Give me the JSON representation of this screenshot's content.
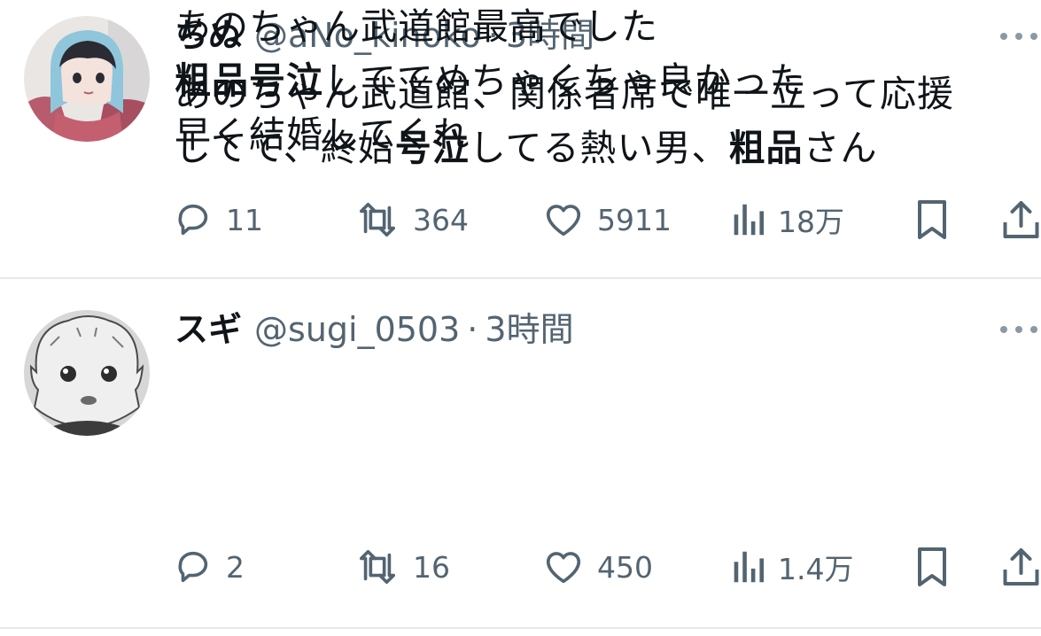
{
  "tweets": [
    {
      "author_name": "ちぬ",
      "handle": "@aNo_kinoko",
      "separator": "·",
      "time": "3時間",
      "text_lines": [
        [
          {
            "t": "あのちゃん武道館、関係者席で唯一立って応援",
            "b": false
          }
        ],
        [
          {
            "t": "してて、終始",
            "b": false
          },
          {
            "t": "号泣",
            "b": true
          },
          {
            "t": "してる熱い男、",
            "b": false
          },
          {
            "t": "粗品",
            "b": true
          },
          {
            "t": "さん",
            "b": false
          }
        ]
      ],
      "replies": "11",
      "retweets": "364",
      "likes": "5911",
      "views": "18万"
    },
    {
      "author_name": "スギ",
      "handle": "@sugi_0503",
      "separator": "·",
      "time": "3時間",
      "text_lines": [
        [
          {
            "t": "あのちゃん武道館最高でした",
            "b": false
          }
        ],
        [
          {
            "t": "粗品号泣",
            "b": true
          },
          {
            "t": "しててめちゃくちゃ良かった",
            "b": false
          }
        ],
        [
          {
            "t": "早く結婚してくれ",
            "b": false
          }
        ]
      ],
      "replies": "2",
      "retweets": "16",
      "likes": "450",
      "views": "1.4万"
    }
  ],
  "icons": {
    "more": "more-horizontal-icon",
    "reply": "reply-icon",
    "retweet": "retweet-icon",
    "like": "heart-icon",
    "views": "views-bar-chart-icon",
    "bookmark": "bookmark-icon",
    "share": "share-icon"
  },
  "colors": {
    "text": "#0f1419",
    "secondary": "#536471",
    "divider": "#e6e9ec"
  }
}
